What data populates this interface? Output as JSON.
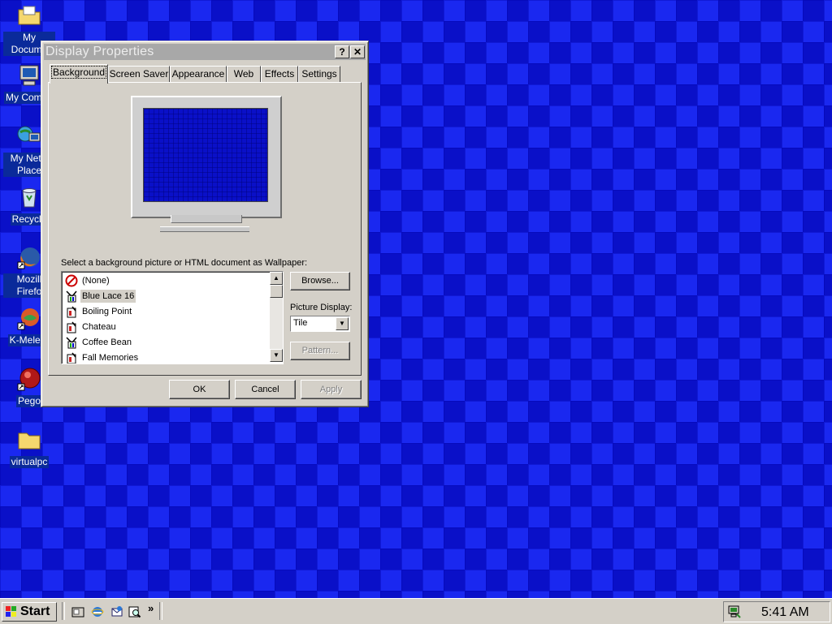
{
  "desktop": {
    "icons": [
      {
        "label": "My Docume",
        "icon": "folder-documents-icon"
      },
      {
        "label": "My Compu",
        "icon": "computer-icon"
      },
      {
        "label": "My Netw Place",
        "icon": "network-places-icon"
      },
      {
        "label": "Recycle",
        "icon": "recycle-bin-icon"
      },
      {
        "label": "Mozill Firefo",
        "icon": "firefox-icon"
      },
      {
        "label": "K-Meleor",
        "icon": "k-meleon-icon"
      },
      {
        "label": "Pego",
        "icon": "pego-icon"
      },
      {
        "label": "virtualpc",
        "icon": "folder-icon"
      }
    ]
  },
  "window": {
    "title": "Display Properties",
    "help_label": "?",
    "close_label": "✕",
    "tabs": [
      {
        "label": "Background",
        "active": true
      },
      {
        "label": "Screen Saver",
        "active": false
      },
      {
        "label": "Appearance",
        "active": false
      },
      {
        "label": "Web",
        "active": false
      },
      {
        "label": "Effects",
        "active": false
      },
      {
        "label": "Settings",
        "active": false
      }
    ],
    "background": {
      "prompt": "Select a background picture or HTML document as Wallpaper:",
      "wallpapers": [
        {
          "label": "(None)",
          "icon": "none-icon",
          "selected": false
        },
        {
          "label": "Blue Lace 16",
          "icon": "paint-icon",
          "selected": true
        },
        {
          "label": "Boiling Point",
          "icon": "html-doc-icon",
          "selected": false
        },
        {
          "label": "Chateau",
          "icon": "html-doc-icon",
          "selected": false
        },
        {
          "label": "Coffee Bean",
          "icon": "paint-icon",
          "selected": false
        },
        {
          "label": "Fall Memories",
          "icon": "html-doc-icon",
          "selected": false
        }
      ],
      "browse_label": "Browse...",
      "picture_display_label": "Picture Display:",
      "picture_display_value": "Tile",
      "pattern_label": "Pattern..."
    },
    "buttons": {
      "ok": "OK",
      "cancel": "Cancel",
      "apply": "Apply"
    }
  },
  "taskbar": {
    "start_label": "Start",
    "quick_launch": [
      "show-desktop-icon",
      "ie-icon",
      "outlook-icon",
      "search-icon"
    ],
    "overflow_label": "»",
    "clock": "5:41 AM"
  },
  "colors": {
    "wallpaper": "#0a10c8",
    "face": "#d4d0c8",
    "titlebar_inactive": "#a8a8a8"
  }
}
